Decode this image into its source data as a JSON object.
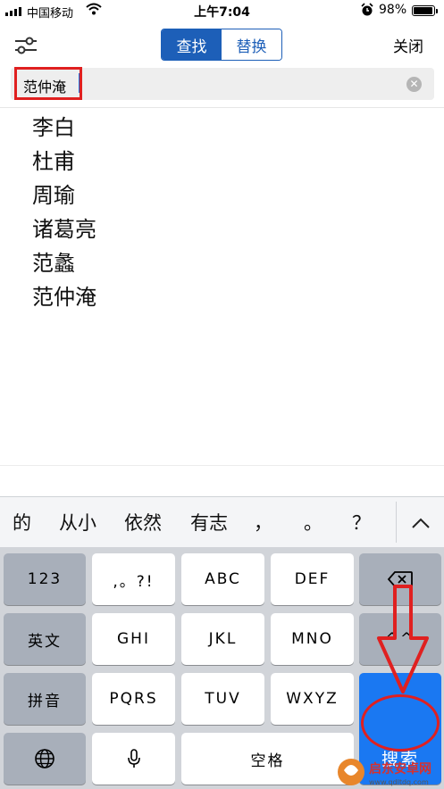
{
  "status_bar": {
    "carrier": "中国移动",
    "time": "上午7:04",
    "battery_percent": "98%"
  },
  "toolbar": {
    "tabs": [
      {
        "label": "查找",
        "selected": true
      },
      {
        "label": "替换",
        "selected": false
      }
    ],
    "close_label": "关闭"
  },
  "search": {
    "value": "范仲淹"
  },
  "results": [
    "李白",
    "杜甫",
    "周瑜",
    "诸葛亮",
    "范蠡",
    "范仲淹"
  ],
  "candidates": [
    "的",
    "从小",
    "依然",
    "有志",
    "，",
    "。",
    "？"
  ],
  "keyboard": {
    "row1": [
      "123",
      ",。?!",
      "ABC",
      "DEF"
    ],
    "row2": [
      "英文",
      "GHI",
      "JKL",
      "MNO",
      "^^"
    ],
    "row3": [
      "拼音",
      "PQRS",
      "TUV",
      "WXYZ"
    ],
    "space_label": "空格",
    "search_label": "搜索"
  },
  "watermark": {
    "name": "启东安卓网",
    "url": "www.qdltdq.com"
  },
  "colors": {
    "accent": "#1d5fb8",
    "search_key": "#1a78f2",
    "annotation_red": "#e02020"
  }
}
